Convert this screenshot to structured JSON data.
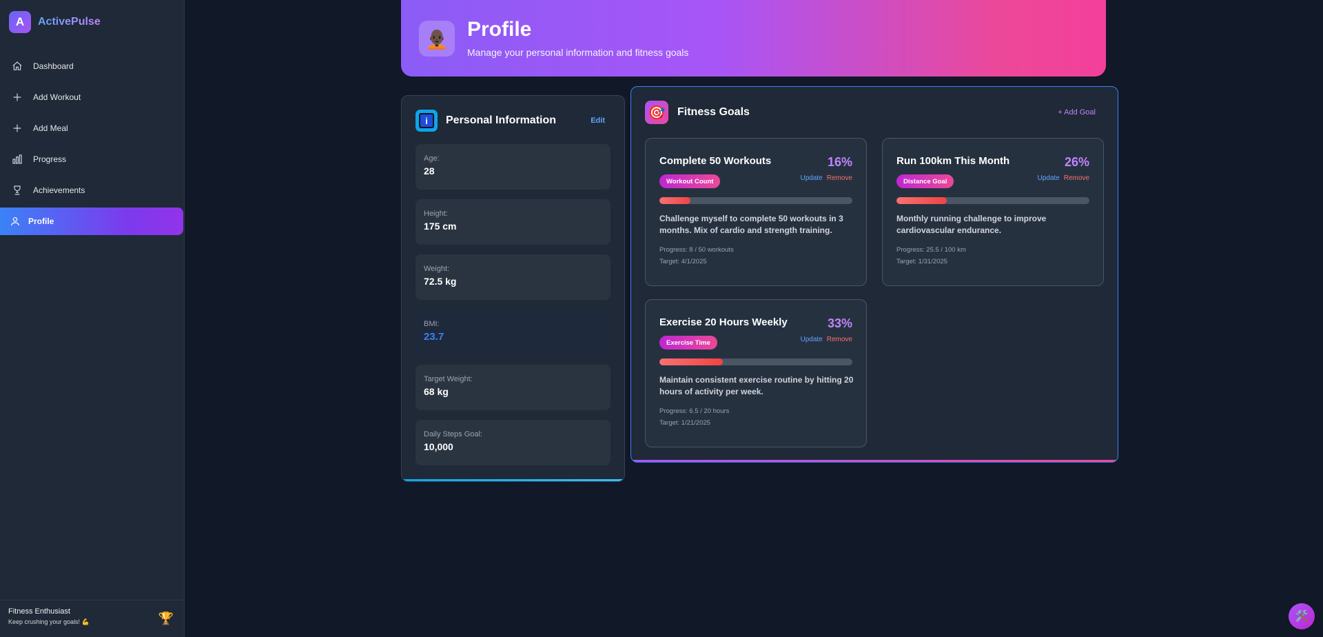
{
  "brand": {
    "logo_letter": "A",
    "name": "ActivePulse"
  },
  "sidebar": {
    "items": [
      {
        "label": "Dashboard",
        "icon": "home-icon"
      },
      {
        "label": "Add Workout",
        "icon": "plus-icon"
      },
      {
        "label": "Add Meal",
        "icon": "plus-icon"
      },
      {
        "label": "Progress",
        "icon": "bar-chart-icon"
      },
      {
        "label": "Achievements",
        "icon": "trophy-outline-icon"
      },
      {
        "label": "Profile",
        "icon": "user-icon",
        "active": true
      }
    ],
    "footer": {
      "title": "Fitness Enthusiast",
      "subtitle": "Keep crushing your goals! 💪",
      "badge": "🏆"
    }
  },
  "header": {
    "icon": "🧑🏿‍🦲",
    "title": "Profile",
    "subtitle": "Manage your personal information and fitness goals"
  },
  "personal_info": {
    "title": "Personal Information",
    "edit_label": "Edit",
    "fields": [
      {
        "label": "Age:",
        "value": "28"
      },
      {
        "label": "Height:",
        "value": "175 cm"
      },
      {
        "label": "Weight:",
        "value": "72.5 kg"
      },
      {
        "label": "BMI:",
        "value": "23.7"
      },
      {
        "label": "Target Weight:",
        "value": "68 kg"
      },
      {
        "label": "Daily Steps Goal:",
        "value": "10,000"
      }
    ]
  },
  "fitness_goals": {
    "icon": "🎯",
    "title": "Fitness Goals",
    "add_label": "+ Add Goal",
    "goals": [
      {
        "title": "Complete 50 Workouts",
        "percent": "16%",
        "progress": 0.16,
        "badge": "Workout Count",
        "update": "Update",
        "remove": "Remove",
        "description": "Challenge myself to complete 50 workouts in 3 months. Mix of cardio and strength training.",
        "progress_text": "Progress: 8 / 50 workouts",
        "target_text": "Target: 4/1/2025"
      },
      {
        "title": "Run 100km This Month",
        "percent": "26%",
        "progress": 0.26,
        "badge": "Distance Goal",
        "update": "Update",
        "remove": "Remove",
        "description": "Monthly running challenge to improve cardiovascular endurance.",
        "progress_text": "Progress: 25.5 / 100 km",
        "target_text": "Target: 1/31/2025"
      },
      {
        "title": "Exercise 20 Hours Weekly",
        "percent": "33%",
        "progress": 0.33,
        "badge": "Exercise Time",
        "update": "Update",
        "remove": "Remove",
        "description": "Maintain consistent exercise routine by hitting 20 hours of activity per week.",
        "progress_text": "Progress: 6.5 / 20 hours",
        "target_text": "Target: 1/21/2025"
      }
    ]
  },
  "fab": {
    "icon": "🛠️"
  }
}
